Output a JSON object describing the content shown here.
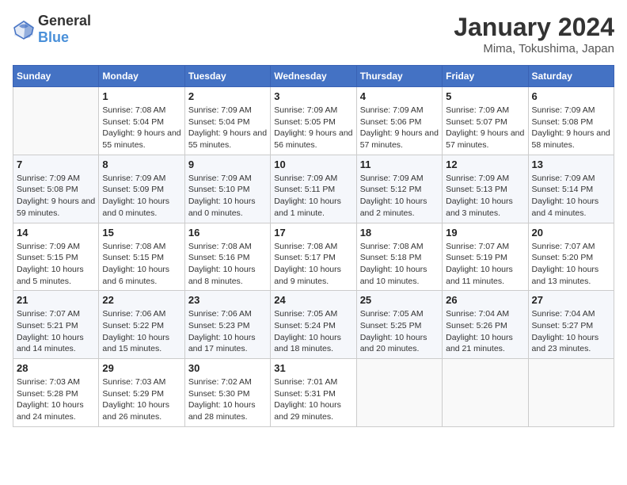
{
  "header": {
    "logo": {
      "general": "General",
      "blue": "Blue"
    },
    "title": "January 2024",
    "location": "Mima, Tokushima, Japan"
  },
  "weekdays": [
    "Sunday",
    "Monday",
    "Tuesday",
    "Wednesday",
    "Thursday",
    "Friday",
    "Saturday"
  ],
  "weeks": [
    [
      {
        "day": "",
        "info": ""
      },
      {
        "day": "1",
        "info": "Sunrise: 7:08 AM\nSunset: 5:04 PM\nDaylight: 9 hours and 55 minutes."
      },
      {
        "day": "2",
        "info": "Sunrise: 7:09 AM\nSunset: 5:04 PM\nDaylight: 9 hours and 55 minutes."
      },
      {
        "day": "3",
        "info": "Sunrise: 7:09 AM\nSunset: 5:05 PM\nDaylight: 9 hours and 56 minutes."
      },
      {
        "day": "4",
        "info": "Sunrise: 7:09 AM\nSunset: 5:06 PM\nDaylight: 9 hours and 57 minutes."
      },
      {
        "day": "5",
        "info": "Sunrise: 7:09 AM\nSunset: 5:07 PM\nDaylight: 9 hours and 57 minutes."
      },
      {
        "day": "6",
        "info": "Sunrise: 7:09 AM\nSunset: 5:08 PM\nDaylight: 9 hours and 58 minutes."
      }
    ],
    [
      {
        "day": "7",
        "info": "Sunrise: 7:09 AM\nSunset: 5:08 PM\nDaylight: 9 hours and 59 minutes."
      },
      {
        "day": "8",
        "info": "Sunrise: 7:09 AM\nSunset: 5:09 PM\nDaylight: 10 hours and 0 minutes."
      },
      {
        "day": "9",
        "info": "Sunrise: 7:09 AM\nSunset: 5:10 PM\nDaylight: 10 hours and 0 minutes."
      },
      {
        "day": "10",
        "info": "Sunrise: 7:09 AM\nSunset: 5:11 PM\nDaylight: 10 hours and 1 minute."
      },
      {
        "day": "11",
        "info": "Sunrise: 7:09 AM\nSunset: 5:12 PM\nDaylight: 10 hours and 2 minutes."
      },
      {
        "day": "12",
        "info": "Sunrise: 7:09 AM\nSunset: 5:13 PM\nDaylight: 10 hours and 3 minutes."
      },
      {
        "day": "13",
        "info": "Sunrise: 7:09 AM\nSunset: 5:14 PM\nDaylight: 10 hours and 4 minutes."
      }
    ],
    [
      {
        "day": "14",
        "info": "Sunrise: 7:09 AM\nSunset: 5:15 PM\nDaylight: 10 hours and 5 minutes."
      },
      {
        "day": "15",
        "info": "Sunrise: 7:08 AM\nSunset: 5:15 PM\nDaylight: 10 hours and 6 minutes."
      },
      {
        "day": "16",
        "info": "Sunrise: 7:08 AM\nSunset: 5:16 PM\nDaylight: 10 hours and 8 minutes."
      },
      {
        "day": "17",
        "info": "Sunrise: 7:08 AM\nSunset: 5:17 PM\nDaylight: 10 hours and 9 minutes."
      },
      {
        "day": "18",
        "info": "Sunrise: 7:08 AM\nSunset: 5:18 PM\nDaylight: 10 hours and 10 minutes."
      },
      {
        "day": "19",
        "info": "Sunrise: 7:07 AM\nSunset: 5:19 PM\nDaylight: 10 hours and 11 minutes."
      },
      {
        "day": "20",
        "info": "Sunrise: 7:07 AM\nSunset: 5:20 PM\nDaylight: 10 hours and 13 minutes."
      }
    ],
    [
      {
        "day": "21",
        "info": "Sunrise: 7:07 AM\nSunset: 5:21 PM\nDaylight: 10 hours and 14 minutes."
      },
      {
        "day": "22",
        "info": "Sunrise: 7:06 AM\nSunset: 5:22 PM\nDaylight: 10 hours and 15 minutes."
      },
      {
        "day": "23",
        "info": "Sunrise: 7:06 AM\nSunset: 5:23 PM\nDaylight: 10 hours and 17 minutes."
      },
      {
        "day": "24",
        "info": "Sunrise: 7:05 AM\nSunset: 5:24 PM\nDaylight: 10 hours and 18 minutes."
      },
      {
        "day": "25",
        "info": "Sunrise: 7:05 AM\nSunset: 5:25 PM\nDaylight: 10 hours and 20 minutes."
      },
      {
        "day": "26",
        "info": "Sunrise: 7:04 AM\nSunset: 5:26 PM\nDaylight: 10 hours and 21 minutes."
      },
      {
        "day": "27",
        "info": "Sunrise: 7:04 AM\nSunset: 5:27 PM\nDaylight: 10 hours and 23 minutes."
      }
    ],
    [
      {
        "day": "28",
        "info": "Sunrise: 7:03 AM\nSunset: 5:28 PM\nDaylight: 10 hours and 24 minutes."
      },
      {
        "day": "29",
        "info": "Sunrise: 7:03 AM\nSunset: 5:29 PM\nDaylight: 10 hours and 26 minutes."
      },
      {
        "day": "30",
        "info": "Sunrise: 7:02 AM\nSunset: 5:30 PM\nDaylight: 10 hours and 28 minutes."
      },
      {
        "day": "31",
        "info": "Sunrise: 7:01 AM\nSunset: 5:31 PM\nDaylight: 10 hours and 29 minutes."
      },
      {
        "day": "",
        "info": ""
      },
      {
        "day": "",
        "info": ""
      },
      {
        "day": "",
        "info": ""
      }
    ]
  ]
}
